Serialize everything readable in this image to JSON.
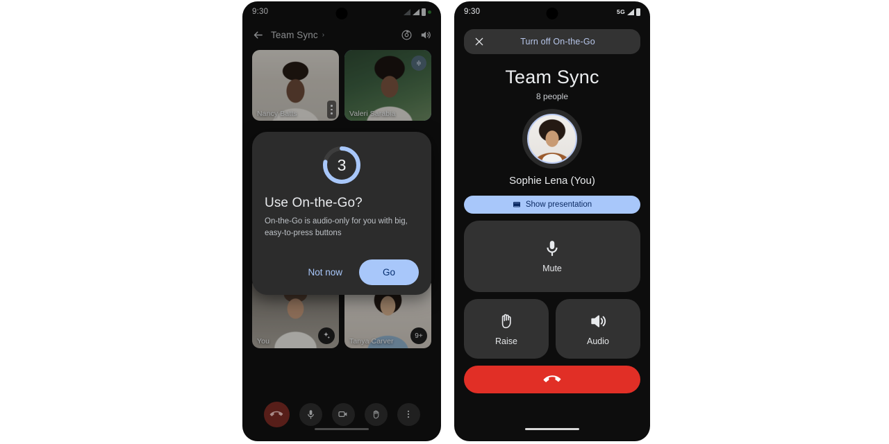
{
  "meta": {
    "background": "#ffffff",
    "accent_blue": "#a8c7fa",
    "danger_red": "#e12f26"
  },
  "left_phone": {
    "status": {
      "clock": "9:30",
      "battery_icon": "battery-icon",
      "signal_icon": "signal-icon"
    },
    "appbar": {
      "back_icon": "back-arrow-icon",
      "title": "Team Sync",
      "caret": "›",
      "switch_camera_icon": "switch-camera-icon",
      "volume_icon": "volume-up-icon"
    },
    "tiles": [
      {
        "name": "Nancy Batts",
        "badge": "more-vertical-icon",
        "selected": false
      },
      {
        "name": "Valeri Sarabia",
        "badge": "mic-active-icon",
        "selected": true
      },
      {
        "name": "You",
        "badge": "effects-sparkle-icon",
        "selected": false
      },
      {
        "name": "Tanya Carver",
        "badge": "9+",
        "selected": false
      }
    ],
    "dialog": {
      "countdown": "3",
      "countdown_progress_percent": 78,
      "title": "Use On-the-Go?",
      "body": "On-the-Go is audio-only for you with big, easy-to-press buttons",
      "dismiss_label": "Not now",
      "confirm_label": "Go"
    },
    "controls": [
      {
        "name": "end-call",
        "icon": "end-call-icon"
      },
      {
        "name": "microphone",
        "icon": "microphone-icon"
      },
      {
        "name": "camera",
        "icon": "video-camera-icon"
      },
      {
        "name": "raise-hand",
        "icon": "raised-hand-icon"
      },
      {
        "name": "more-options",
        "icon": "more-vertical-icon"
      }
    ]
  },
  "right_phone": {
    "status": {
      "clock": "9:30",
      "network": "5G",
      "battery_icon": "battery-icon",
      "signal_icon": "signal-icon"
    },
    "turn_off_bar": {
      "close_icon": "close-x-icon",
      "label": "Turn off On-the-Go"
    },
    "meeting_title": "Team Sync",
    "people_count": "8 people",
    "self_name": "Sophie Lena (You)",
    "present_button": {
      "icon": "present-screen-icon",
      "label": "Show presentation"
    },
    "mute_button": {
      "icon": "microphone-icon",
      "label": "Mute"
    },
    "raise_button": {
      "icon": "raised-hand-icon",
      "label": "Raise"
    },
    "audio_button": {
      "icon": "volume-up-icon",
      "label": "Audio"
    },
    "hangup_button": {
      "icon": "end-call-icon",
      "label": ""
    }
  }
}
